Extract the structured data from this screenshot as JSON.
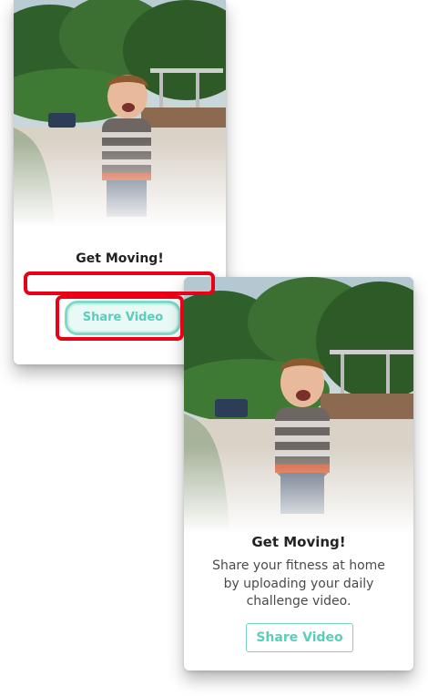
{
  "card_back": {
    "title": "Get Moving!",
    "button_label": "Share Video"
  },
  "card_front": {
    "title": "Get Moving!",
    "description": "Share your fitness at home by uploading your daily challenge video.",
    "button_label": "Share Video"
  },
  "colors": {
    "accent": "#5ccdb8",
    "highlight": "#ea0016"
  }
}
